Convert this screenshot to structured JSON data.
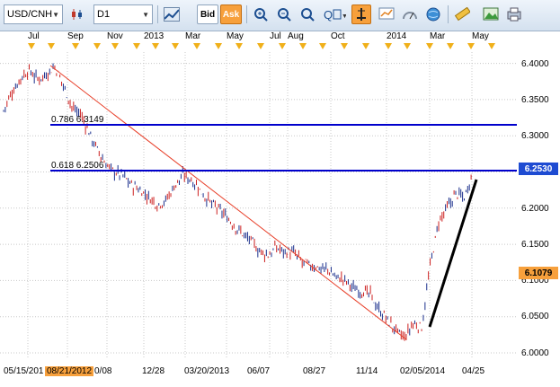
{
  "toolbar": {
    "symbol": "USD/CNH",
    "timeframe": "D1",
    "bid_label": "Bid",
    "ask_label": "Ask"
  },
  "top_axis": {
    "labels": [
      "Jul",
      "Sep",
      "Nov",
      "2013",
      "Mar",
      "May",
      "Jul",
      "Aug",
      "Oct",
      "2014",
      "Mar",
      "May"
    ]
  },
  "bottom_axis": {
    "labels": [
      "05/15/201",
      "08/21/2012",
      "0/08",
      "12/28",
      "03/20/2013",
      "06/07",
      "08/27",
      "11/14",
      "02/05/2014",
      "04/25"
    ]
  },
  "price_axis": {
    "labels": [
      "6.4000",
      "6.3500",
      "6.3000",
      "6.2500",
      "6.2000",
      "6.1500",
      "6.1000",
      "6.0500",
      "6.0000"
    ],
    "current_price": "6.2530",
    "second_marker": "6.1079"
  },
  "fibonacci": {
    "level_786": "0.786 6.3149",
    "level_618": "0.618 6.2506"
  },
  "colors": {
    "fib_line": "#0000cc",
    "trend_line": "#e8402a",
    "support_line": "#000000",
    "candle_up": "#1a2f8c",
    "candle_down": "#cc1f1f",
    "price_box": "#1e4bd2",
    "marker_box": "#f7a03c"
  },
  "chart_data": {
    "type": "line",
    "ylim": [
      6.0,
      6.41
    ],
    "series": [
      {
        "values": [
          6.335,
          6.36,
          6.38,
          6.39,
          6.378,
          6.385,
          6.395,
          6.37,
          6.34,
          6.33,
          6.305,
          6.28,
          6.26,
          6.25,
          6.245,
          6.232,
          6.225,
          6.215,
          6.205,
          6.21,
          6.23,
          6.245,
          6.24,
          6.225,
          6.21,
          6.2,
          6.19,
          6.175,
          6.165,
          6.155,
          6.14,
          6.135,
          6.145,
          6.14,
          6.138,
          6.125,
          6.12,
          6.118,
          6.115,
          6.105,
          6.1,
          6.09,
          6.085,
          6.08,
          6.06,
          6.045,
          6.03,
          6.02,
          6.04,
          6.035,
          6.12,
          6.18,
          6.2,
          6.22,
          6.215,
          6.25
        ]
      }
    ]
  }
}
